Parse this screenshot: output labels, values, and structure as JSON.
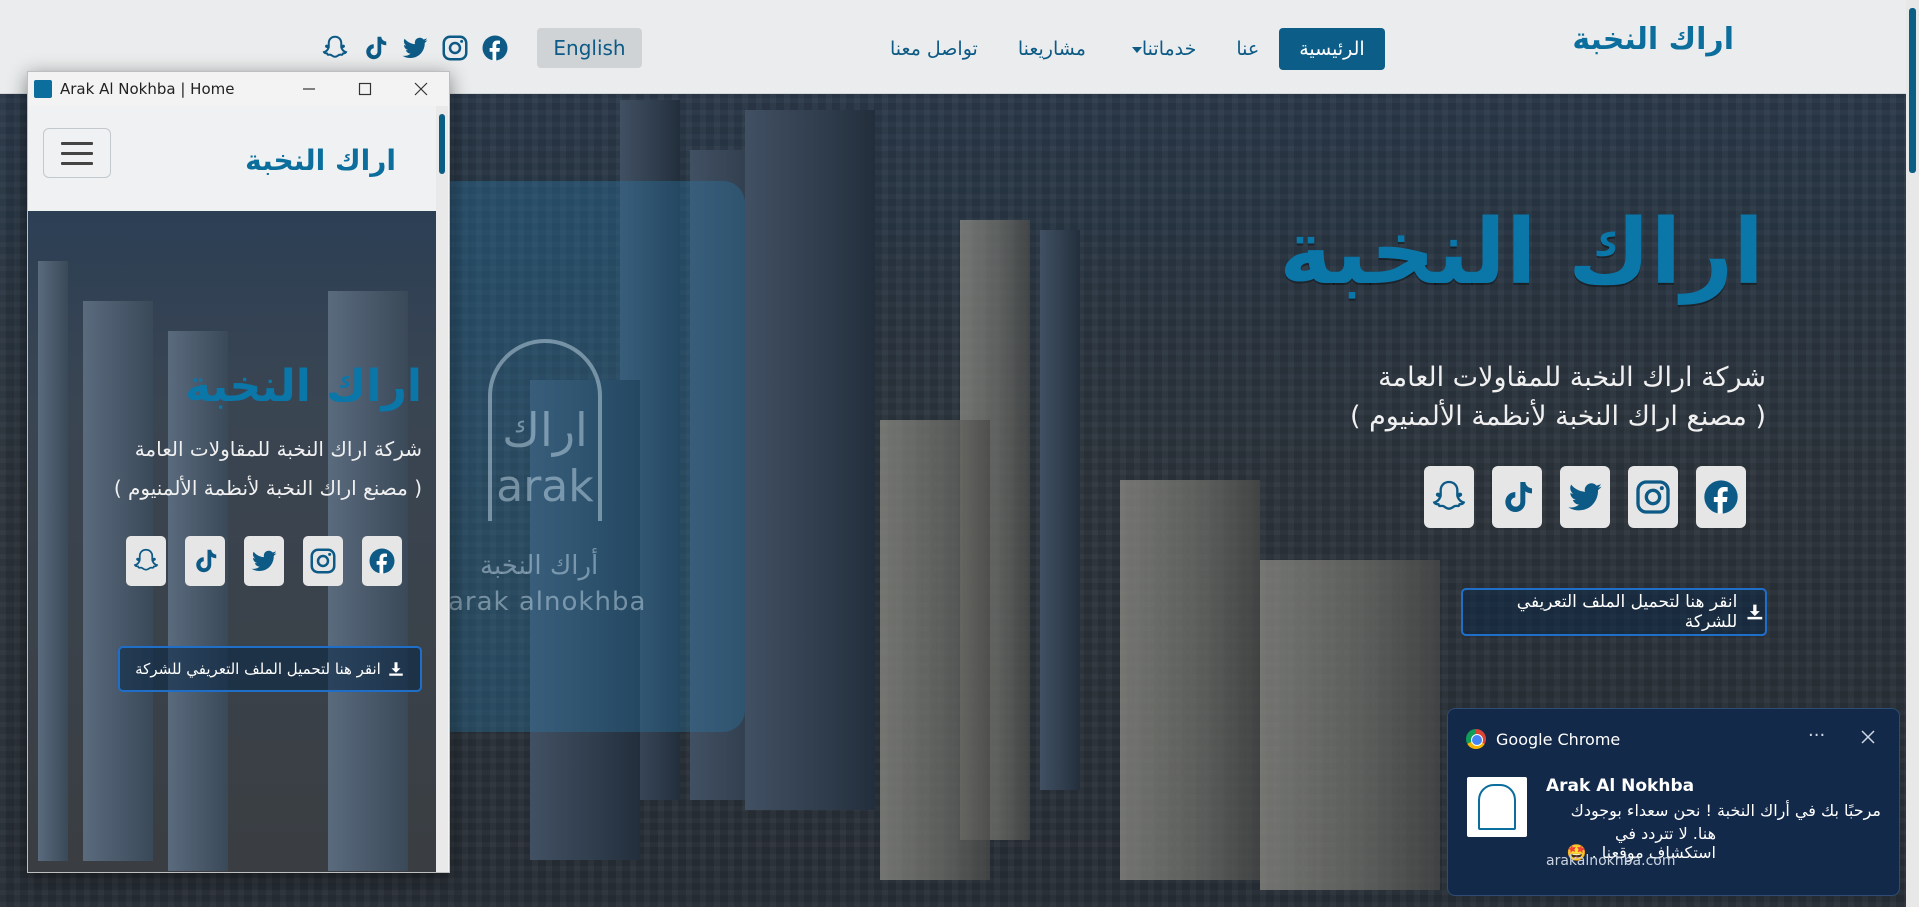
{
  "colors": {
    "brand": "#0b6e9c",
    "nav_active_bg": "#0c5d87",
    "notification_bg": "#13294a"
  },
  "navbar": {
    "brand": "اراك النخبة",
    "links": [
      "الرئيسية",
      "عنا",
      "خدماتنا",
      "مشاريعنا",
      "تواصل معنا"
    ],
    "language_button": "English",
    "social_icons": [
      "facebook-icon",
      "instagram-icon",
      "twitter-icon",
      "tiktok-icon",
      "snapchat-icon"
    ]
  },
  "hero": {
    "title": "اراك النخبة",
    "subtitle_line1": "شركة اراك النخبة للمقاولات العامة",
    "subtitle_line2": "( مصنع اراك النخبة لأنظمة الألمنيوم )",
    "download_button": "انقر هنا لتحميل الملف التعريفي للشركة",
    "logo_ar": "أراك النخبة",
    "logo_en": "arak alnokhba"
  },
  "mobile_window": {
    "title": "Arak Al Nokhba | Home",
    "brand": "اراك النخبة",
    "hero_title": "اراك النخبة",
    "subtitle_line1": "شركة اراك النخبة للمقاولات العامة",
    "subtitle_line2": "( مصنع اراك النخبة لأنظمة الألمنيوم )",
    "download_button": "انقر هنا لتحميل الملف التعريفي للشركة"
  },
  "notification": {
    "app_name": "Google Chrome",
    "more": "···",
    "title": "Arak Al Nokhba",
    "message_line1": "مرحبًا بك في أراك النخبة ! نحن سعداء بوجودك",
    "message_line2": "هنا. لا تتردد في استكشاف موقعنا . 🤩",
    "url": "arakalnokhba.com"
  }
}
